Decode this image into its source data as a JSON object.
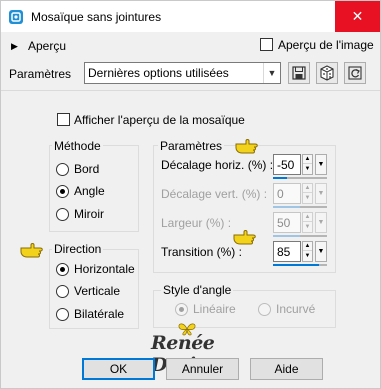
{
  "title": "Mosaïque sans jointures",
  "close_glyph": "✕",
  "preview_toggle": {
    "label": "Aperçu",
    "glyph": "▶"
  },
  "image_preview": {
    "label": "Aperçu de l'image",
    "checked": false
  },
  "presets": {
    "label": "Paramètres",
    "value": "Dernières options utilisées"
  },
  "show_mosaic_preview": {
    "label": "Afficher l'aperçu de la mosaïque",
    "checked": false
  },
  "method": {
    "title": "Méthode",
    "options": [
      {
        "label": "Bord",
        "checked": false
      },
      {
        "label": "Angle",
        "checked": true
      },
      {
        "label": "Miroir",
        "checked": false
      }
    ]
  },
  "direction": {
    "title": "Direction",
    "options": [
      {
        "label": "Horizontale",
        "checked": true
      },
      {
        "label": "Verticale",
        "checked": false
      },
      {
        "label": "Bilatérale",
        "checked": false
      }
    ]
  },
  "parameters": {
    "title": "Paramètres",
    "fields": [
      {
        "label": "Décalage horiz. (%) :",
        "value": "-50",
        "enabled": true,
        "level": 0.25
      },
      {
        "label": "Décalage vert. (%) :",
        "value": "0",
        "enabled": false,
        "level": 0.5
      },
      {
        "label": "Largeur (%) :",
        "value": "50",
        "enabled": false,
        "level": 0.5
      },
      {
        "label": "Transition (%) :",
        "value": "85",
        "enabled": true,
        "level": 0.85
      }
    ]
  },
  "corner_style": {
    "title": "Style d'angle",
    "options": [
      {
        "label": "Linéaire",
        "checked": true
      },
      {
        "label": "Incurvé",
        "checked": false
      }
    ]
  },
  "buttons": {
    "ok": "OK",
    "cancel": "Annuler",
    "help": "Aide"
  },
  "watermark": {
    "text": "Renée Design"
  },
  "colors": {
    "accent": "#0078d7",
    "close": "#e81123",
    "pointer": "#f3d21b"
  }
}
